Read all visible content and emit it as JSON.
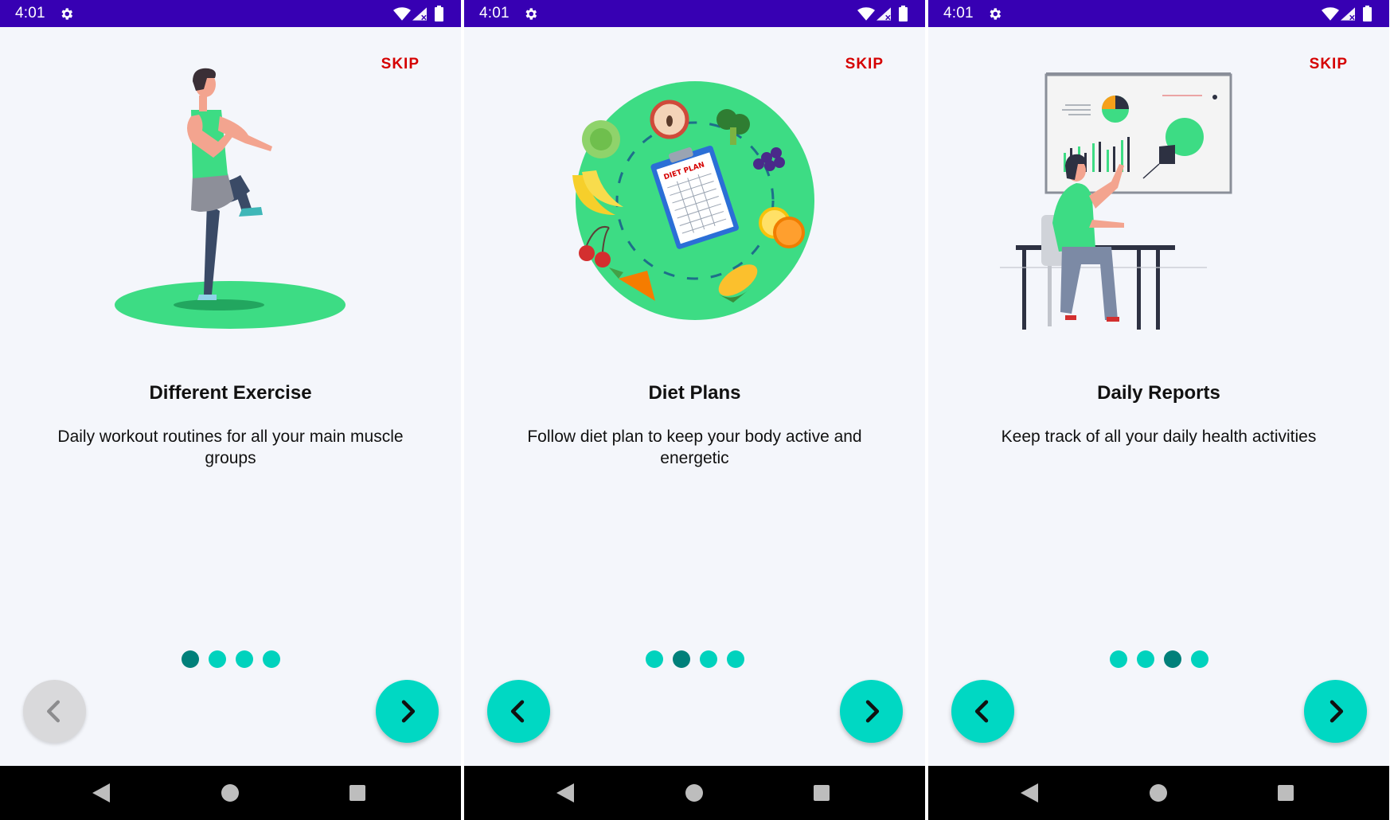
{
  "colors": {
    "status_bar": "#3700b3",
    "accent": "#00d8c3",
    "dot_inactive": "#00d2bd",
    "dot_active": "#00807a",
    "skip": "#d50000",
    "button_disabled": "#d9d9db",
    "background": "#f4f6fb",
    "nav_bar": "#000000"
  },
  "status_icons": [
    "settings-icon",
    "wifi-icon",
    "signal-icon",
    "battery-icon"
  ],
  "system_nav_icons": [
    "back-triangle-icon",
    "home-circle-icon",
    "recents-square-icon"
  ],
  "screens": [
    {
      "status_time": "4:01",
      "skip_label": "SKIP",
      "illustration": "exercise-illustration",
      "title": "Different Exercise",
      "description": "Daily workout routines for all your main muscle groups",
      "page_index": 1,
      "page_count": 4,
      "prev_enabled": false,
      "next_enabled": true
    },
    {
      "status_time": "4:01",
      "skip_label": "SKIP",
      "illustration": "diet-plan-illustration",
      "title": "Diet Plans",
      "description": "Follow diet plan to keep your body active and energetic",
      "page_index": 2,
      "page_count": 4,
      "prev_enabled": true,
      "next_enabled": true
    },
    {
      "status_time": "4:01",
      "skip_label": "SKIP",
      "illustration": "daily-reports-illustration",
      "title": "Daily Reports",
      "description": "Keep track of all your daily health activities",
      "page_index": 3,
      "page_count": 4,
      "prev_enabled": true,
      "next_enabled": true
    }
  ]
}
